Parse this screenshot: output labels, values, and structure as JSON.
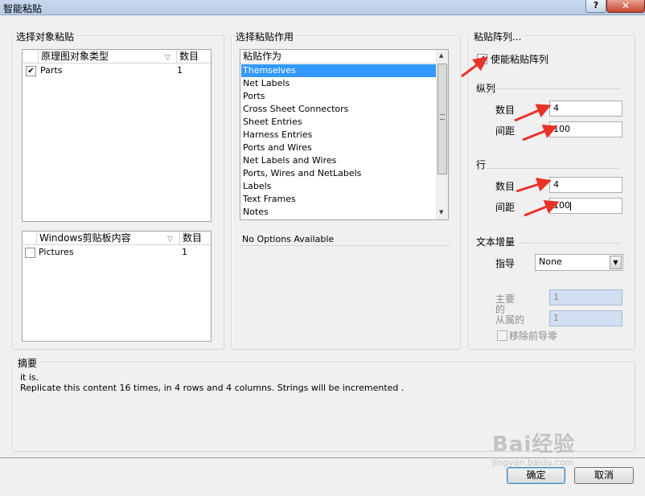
{
  "window": {
    "title": "智能粘贴",
    "help_label": "?",
    "close_label": "✕"
  },
  "paste_objects": {
    "group_title": "选择对象粘贴",
    "schematic_table": {
      "col_type": "原理图对象类型",
      "col_count": "数目",
      "rows": [
        {
          "checked": true,
          "name": "Parts",
          "count": "1"
        }
      ]
    },
    "clipboard_table": {
      "col_type": "Windows剪贴板内容",
      "col_count": "数目",
      "rows": [
        {
          "checked": false,
          "name": "Pictures",
          "count": "1"
        }
      ]
    }
  },
  "paste_action": {
    "group_title": "选择粘贴作用",
    "list_header": "粘贴作为",
    "items": [
      "Themselves",
      "Net Labels",
      "Ports",
      "Cross Sheet Connectors",
      "Sheet Entries",
      "Harness Entries",
      "Ports and Wires",
      "Net Labels and Wires",
      "Ports, Wires and NetLabels",
      "Labels",
      "Text Frames",
      "Notes"
    ],
    "selected_index": 0,
    "options_text": "No Options Available"
  },
  "paste_array": {
    "group_title": "粘贴阵列...",
    "enable_label": "使能粘贴阵列",
    "enable_checked": true,
    "columns_title": "纵列",
    "columns_count_label": "数目",
    "columns_count": "4",
    "columns_spacing_label": "间距",
    "columns_spacing": "100",
    "rows_title": "行",
    "rows_count_label": "数目",
    "rows_count": "4",
    "rows_spacing_label": "间距",
    "rows_spacing": "100",
    "text_increment_title": "文本增量",
    "direction_label": "指导",
    "direction_value": "None",
    "primary_label": "主要",
    "primary_value": "1",
    "secondary_label_1": "的",
    "secondary_label_2": "从属的",
    "secondary_value": "1",
    "remove_zeros_label": "移除前导零"
  },
  "summary": {
    "title": "摘要",
    "line1": "it is.",
    "line2": "Replicate this content 16 times, in 4 rows and 4 columns. Strings will be incremented ."
  },
  "buttons": {
    "ok": "确定",
    "cancel": "取消"
  },
  "watermark": {
    "text": "Bai经验",
    "url": "jingyan.baidu.com"
  },
  "colors": {
    "selection": "#3399ff",
    "arrow": "#e8322a",
    "disabled_field": "#d2dff2"
  }
}
